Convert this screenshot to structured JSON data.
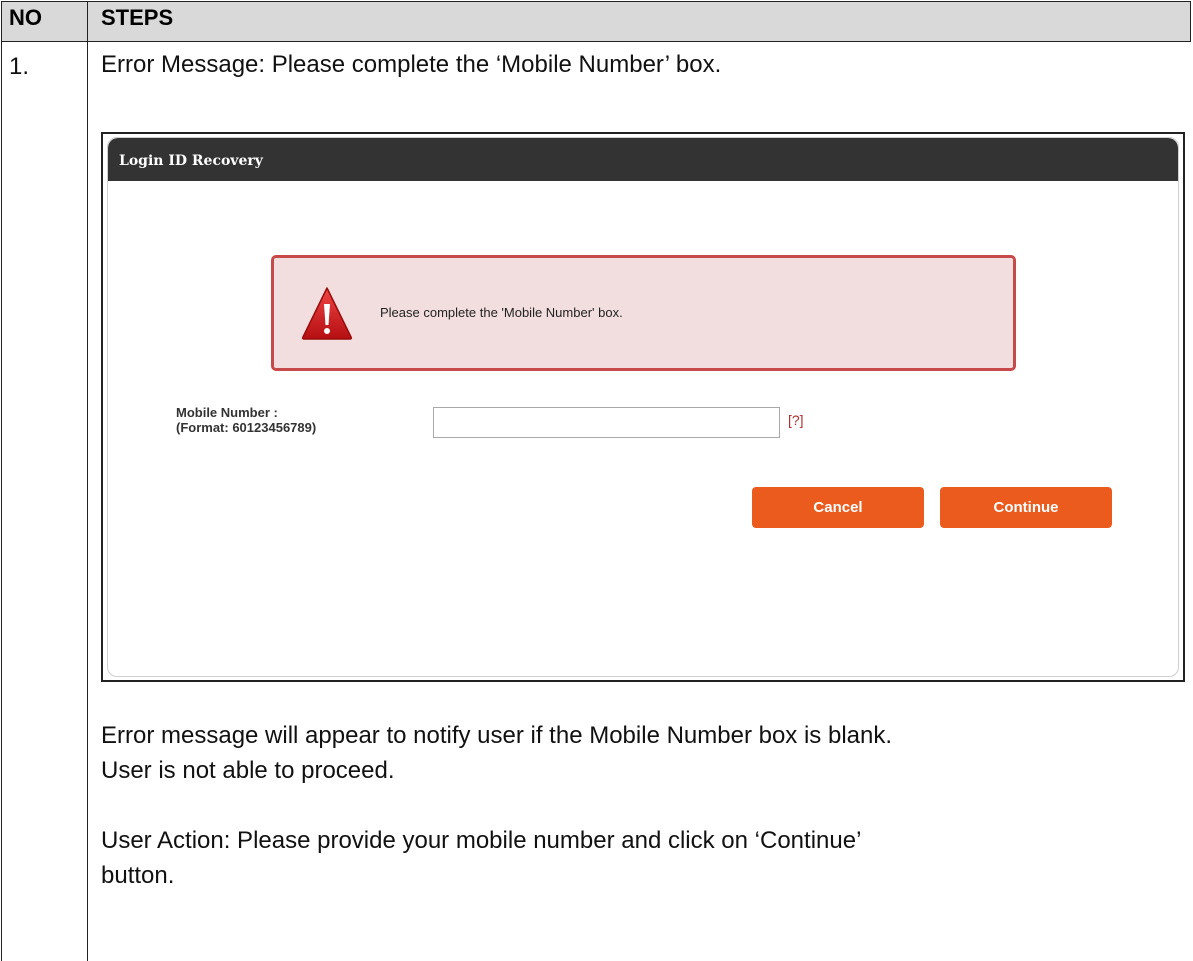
{
  "table": {
    "col_no": "NO",
    "col_steps": "STEPS"
  },
  "row": {
    "no": "1.",
    "heading": "Error Message: Please complete the ‘Mobile Number’ box."
  },
  "screenshot": {
    "title": "Login ID Recovery",
    "error_message": "Please complete the 'Mobile Number' box.",
    "mobile_label_line1": "Mobile Number :",
    "mobile_label_line2": "(Format: 60123456789)",
    "mobile_value": "",
    "help_link": "[?]",
    "cancel_label": "Cancel",
    "continue_label": "Continue",
    "colors": {
      "title_bar": "#333333",
      "error_bg": "#f2dede",
      "error_border": "#c64a4a",
      "button": "#eb5b1e"
    },
    "icons": [
      "warning-triangle-icon"
    ]
  },
  "notes": {
    "line1": "Error message will appear to notify user if the Mobile Number box is blank.",
    "line2": "User is not able to proceed.",
    "line3": "User Action: Please provide your mobile number and click on ‘Continue’",
    "line4": "button."
  }
}
